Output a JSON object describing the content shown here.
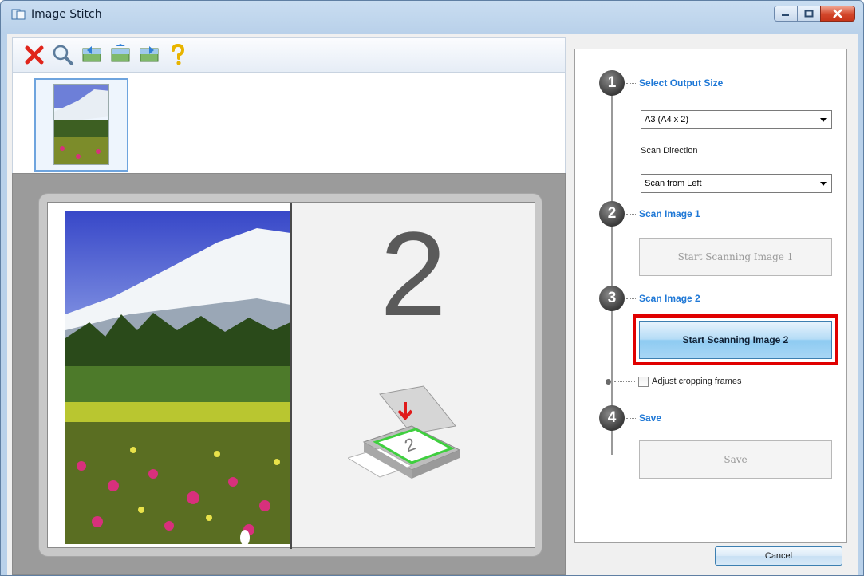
{
  "window": {
    "title": "Image Stitch",
    "icons": [
      "app-icon",
      "minimize-icon",
      "maximize-icon",
      "close-icon"
    ]
  },
  "toolbar": {
    "buttons": [
      {
        "name": "delete-icon",
        "color": "#e0251b"
      },
      {
        "name": "magnifier-icon"
      },
      {
        "name": "swap-left-icon"
      },
      {
        "name": "swap-icon"
      },
      {
        "name": "swap-right-icon"
      },
      {
        "name": "help-icon",
        "color": "#e8b400"
      }
    ]
  },
  "preview": {
    "placeholder_number": "2"
  },
  "steps": {
    "step1": {
      "number": "1",
      "title": "Select Output Size",
      "output_size_value": "A3 (A4 x 2)",
      "scan_direction_label": "Scan Direction",
      "scan_direction_value": "Scan from Left"
    },
    "step2": {
      "number": "2",
      "title": "Scan Image 1",
      "button_label": "Start Scanning Image 1"
    },
    "step3": {
      "number": "3",
      "title": "Scan Image 2",
      "button_label": "Start Scanning Image 2",
      "highlight_color": "#e00000"
    },
    "crop": {
      "label": "Adjust cropping frames"
    },
    "step4": {
      "number": "4",
      "title": "Save",
      "button_label": "Save"
    }
  },
  "footer": {
    "cancel_label": "Cancel"
  },
  "colors": {
    "step_title": "#1f78d6",
    "accent_button": "#8ecbf2"
  }
}
